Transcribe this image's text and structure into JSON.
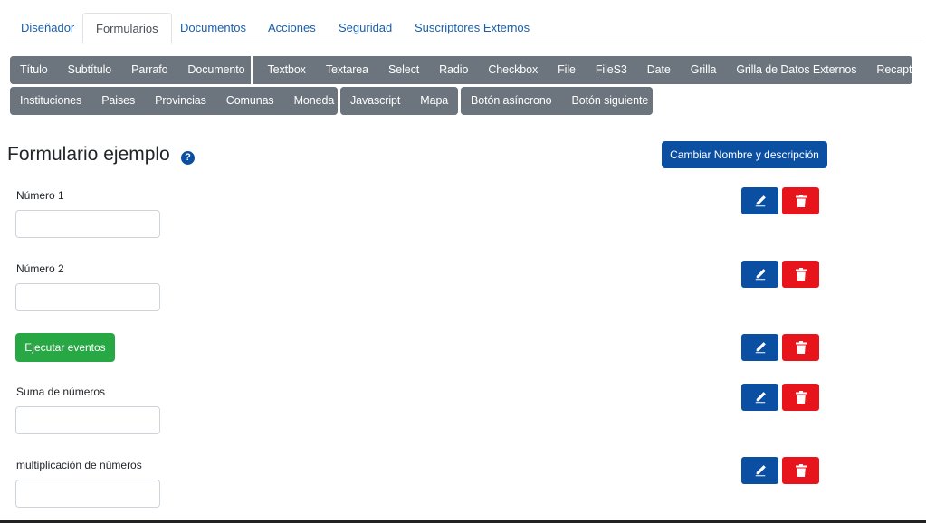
{
  "tabs": [
    {
      "label": "Diseñador",
      "active": false
    },
    {
      "label": "Formularios",
      "active": true
    },
    {
      "label": "Documentos",
      "active": false
    },
    {
      "label": "Acciones",
      "active": false
    },
    {
      "label": "Seguridad",
      "active": false
    },
    {
      "label": "Suscriptores Externos",
      "active": false
    }
  ],
  "toolbar": {
    "row1_group1": [
      "Título",
      "Subtítulo",
      "Parrafo",
      "Documento"
    ],
    "row1_group2": [
      "Textbox",
      "Textarea",
      "Select",
      "Radio",
      "Checkbox",
      "File",
      "FileS3",
      "Date",
      "Grilla",
      "Grilla de Datos Externos",
      "Recaptcha"
    ],
    "row2_group1": [
      "Instituciones",
      "Paises",
      "Provincias",
      "Comunas",
      "Moneda"
    ],
    "row2_group2": [
      "Javascript",
      "Mapa"
    ],
    "row2_group3": [
      "Botón asíncrono",
      "Botón siguiente"
    ]
  },
  "form": {
    "title": "Formulario ejemplo",
    "help_icon": "?",
    "rename_label": "Cambiar Nombre y descripción"
  },
  "fields": [
    {
      "label": "Número 1",
      "value": ""
    },
    {
      "label": "Número 2",
      "value": ""
    },
    {
      "button_label": "Ejecutar eventos"
    },
    {
      "label": "Suma de números",
      "value": ""
    },
    {
      "label": "multiplicación de números",
      "value": ""
    }
  ],
  "icons": {
    "edit": "pencil-icon",
    "delete": "trash-icon"
  },
  "colors": {
    "primary": "#0b4fa3",
    "danger": "#e8141b",
    "success": "#28a745",
    "toolbar": "#6c757d",
    "tab_link": "#1a5fa8"
  }
}
